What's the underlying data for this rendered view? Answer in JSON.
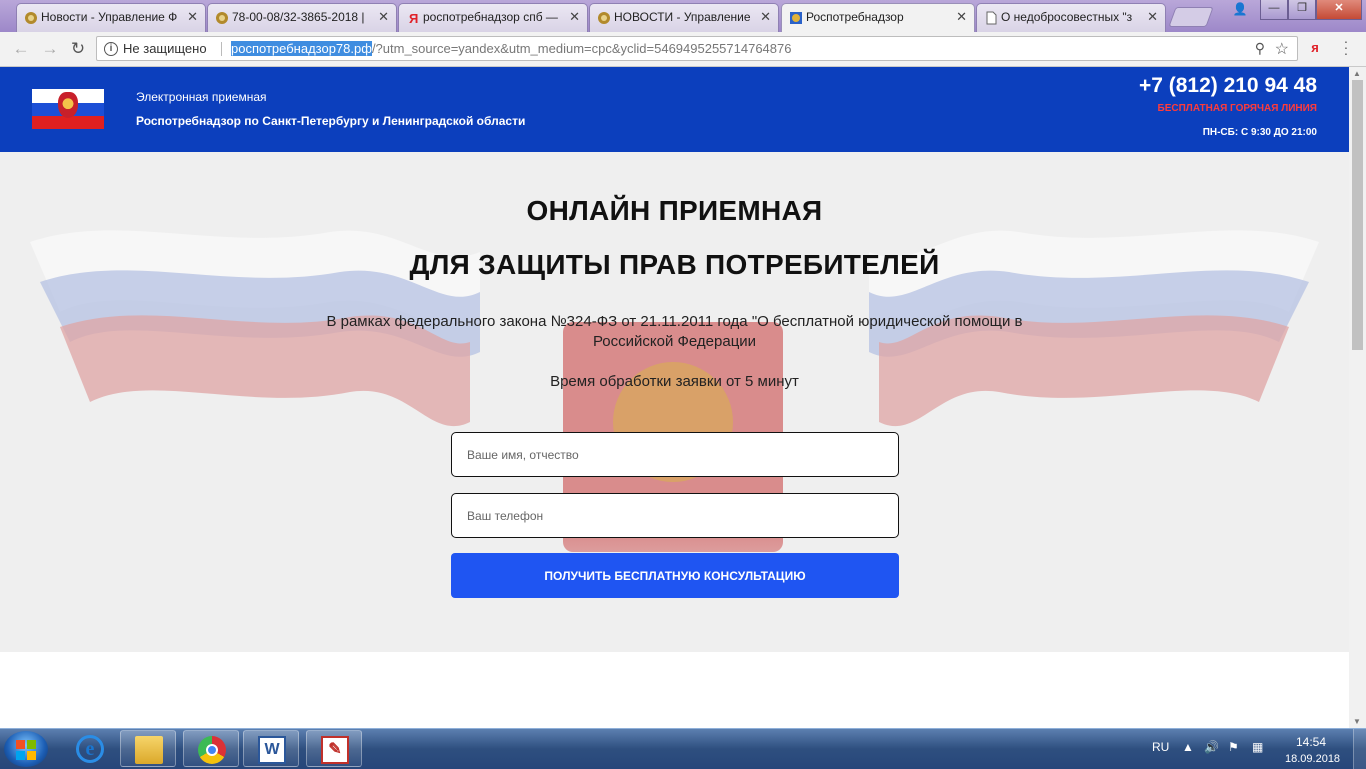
{
  "browser": {
    "tabs": [
      {
        "title": "Новости - Управление Ф",
        "icon": "emblem-icon",
        "active": false
      },
      {
        "title": "78-00-08/32-3865-2018 |",
        "icon": "emblem-icon",
        "active": false
      },
      {
        "title": "роспотребнадзор спб —",
        "icon": "yandex-icon",
        "active": false
      },
      {
        "title": "НОВОСТИ - Управление",
        "icon": "emblem-icon",
        "active": false
      },
      {
        "title": "Роспотребнадзор",
        "icon": "emblem-icon",
        "active": true
      },
      {
        "title": "О недобросовестных \"з",
        "icon": "document-icon",
        "active": false
      }
    ],
    "tab_close_glyph": "✕",
    "security_label": "Не защищено",
    "url_host": "роспотребнадзор78.рф",
    "url_rest": "/?utm_source=yandex&utm_medium=cpc&yclid=5469495255714764876",
    "extension_letter": "я"
  },
  "header": {
    "subtitle": "Электронная приемная",
    "organization": "Роспотребнадзор по Санкт-Петербургу и Ленинградской области",
    "phone": "+7 (812) 210 94 48",
    "hotline": "БЕСПЛАТНАЯ ГОРЯЧАЯ ЛИНИЯ",
    "hours": "ПН-СБ: С 9:30 ДО 21:00"
  },
  "hero": {
    "title_line1": "ОНЛАЙН ПРИЕМНАЯ",
    "title_line2": "ДЛЯ ЗАЩИТЫ ПРАВ ПОТРЕБИТЕЛЕЙ",
    "lead": "В рамках федерального закона №324-ФЗ от 21.11.2011 года \"О бесплатной юридической помощи в Российской Федерации",
    "processing_time": "Время обработки заявки от 5 минут"
  },
  "form": {
    "name_placeholder": "Ваше имя, отчество",
    "name_value": "",
    "phone_placeholder": "Ваш телефон",
    "phone_value": "",
    "submit_label": "ПОЛУЧИТЬ БЕСПЛАТНУЮ КОНСУЛЬТАЦИЮ"
  },
  "taskbar": {
    "language": "RU",
    "time": "14:54",
    "date": "18.09.2018",
    "apps": [
      "ie-icon",
      "folder-icon",
      "chrome-icon",
      "word-icon",
      "pdf-icon"
    ]
  },
  "colors": {
    "header_bg": "#0c3fbd",
    "hotline": "#ff3b3b",
    "cta_bg": "#1f55f2",
    "hero_bg": "#efefef"
  }
}
